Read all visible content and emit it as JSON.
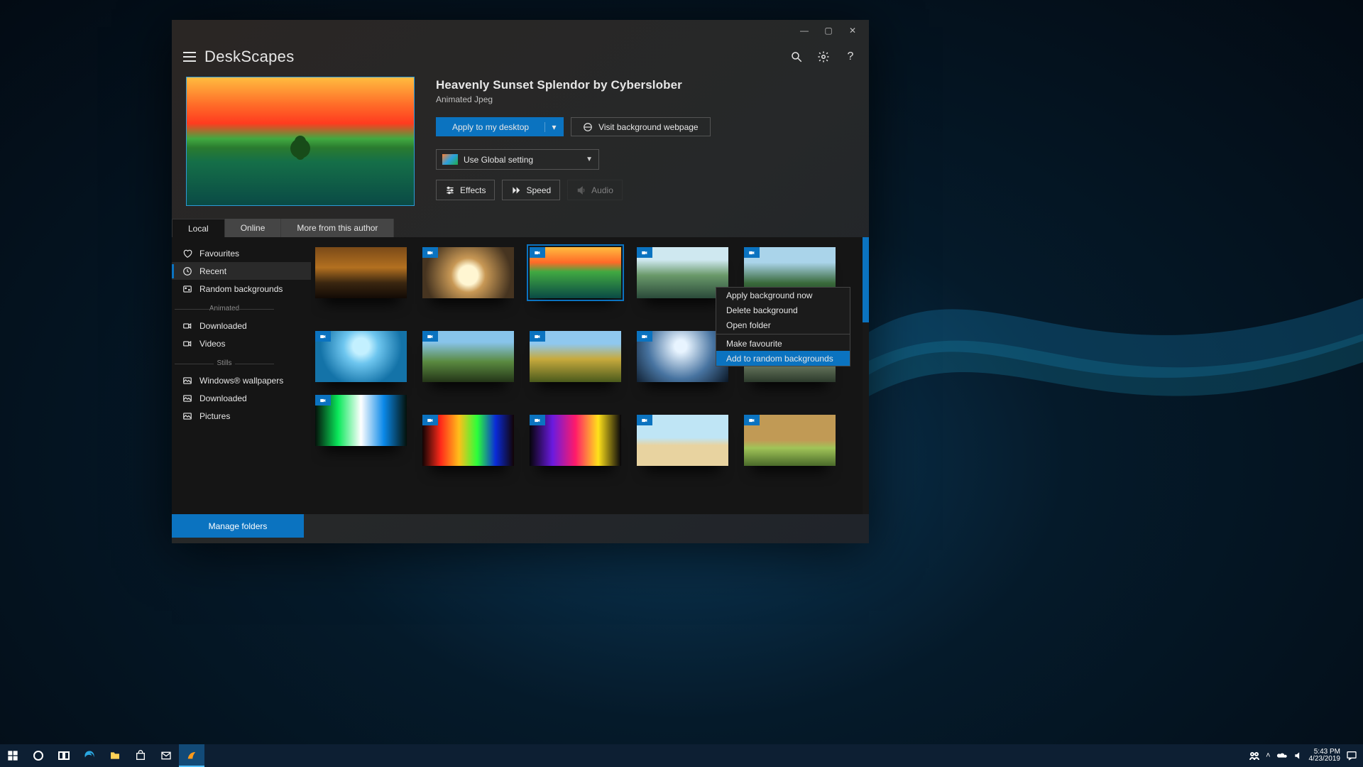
{
  "app": {
    "title": "DeskScapes"
  },
  "titlebar": {
    "min": "—",
    "max": "▢",
    "close": "✕"
  },
  "wallpaper": {
    "title": "Heavenly Sunset Splendor by Cyberslober",
    "subtitle": "Animated Jpeg",
    "apply": "Apply to my desktop",
    "visit": "Visit background webpage",
    "global_setting": "Use Global setting",
    "effects": "Effects",
    "speed": "Speed",
    "audio": "Audio"
  },
  "tabs": {
    "local": "Local",
    "online": "Online",
    "more": "More from this author"
  },
  "sidebar": {
    "favourites": "Favourites",
    "recent": "Recent",
    "random": "Random backgrounds",
    "sep_anim": "Animated",
    "downloaded": "Downloaded",
    "videos": "Videos",
    "sep_still": "Stills",
    "win_wall": "Windows® wallpapers",
    "downloaded2": "Downloaded",
    "pictures": "Pictures"
  },
  "context": {
    "apply": "Apply background now",
    "delete": "Delete background",
    "open": "Open folder",
    "fav": "Make favourite",
    "add": "Add to random backgrounds"
  },
  "footer": {
    "manage": "Manage folders"
  },
  "taskbar": {
    "time": "5:43 PM",
    "date": "4/23/2019"
  }
}
